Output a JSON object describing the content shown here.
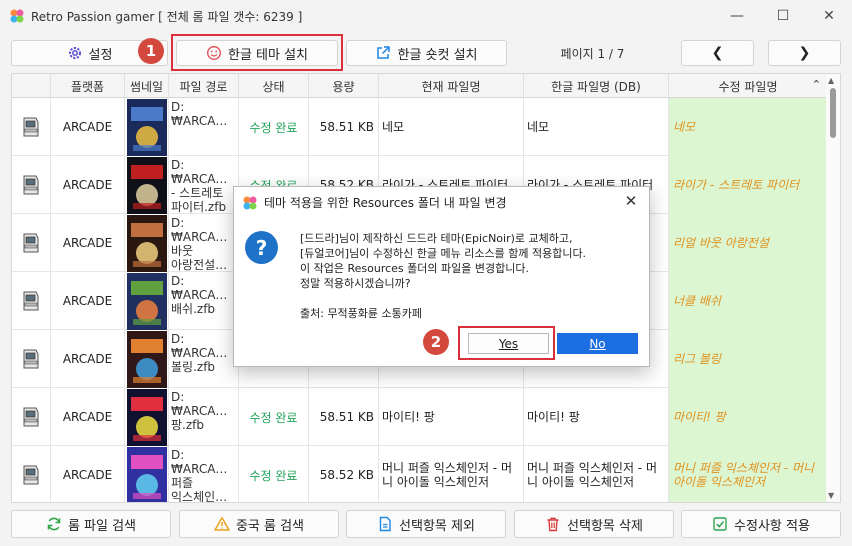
{
  "window": {
    "title": "Retro Passion gamer [ 전체 롬 파일 갯수: 6239 ]",
    "minimize_glyph": "—",
    "maximize_glyph": "☐",
    "close_glyph": "✕"
  },
  "toolbar": {
    "settings_label": "설정",
    "korean_theme_label": "한글 테마 설치",
    "korean_shortcut_label": "한글 숏컷 설치",
    "page_info": "페이지 1 / 7",
    "prev_glyph": "❮",
    "next_glyph": "❯"
  },
  "annotations": {
    "step1": "1",
    "step2": "2",
    "color": "#d9303a"
  },
  "table": {
    "columns": [
      "",
      "플랫폼",
      "썸네일",
      "파일 경로",
      "상태",
      "용량",
      "현재 파일명",
      "한글 파일명 (DB)",
      "수정 파일명"
    ],
    "sort_indicator": "⌃",
    "rows": [
      {
        "platform": "ARCADE",
        "path": "D:\n₩ARCA…",
        "status": "수정 완료",
        "size": "58.51 KB",
        "current": "네모",
        "korean_db": "네모",
        "modified": "네모"
      },
      {
        "platform": "ARCADE",
        "path": "D:\n₩ARCA…\n- 스트레토\n파이터.zfb",
        "status": "수정 완료",
        "size": "58.52 KB",
        "current": "라이가 - 스트레토 파이터",
        "korean_db": "라이가 - 스트레토 파이터",
        "modified": "라이가 - 스트레토 파이터"
      },
      {
        "platform": "ARCADE",
        "path": "D:\n₩ARCA…\n바웃\n아랑전설…",
        "status": "",
        "size": "",
        "current": "",
        "korean_db": "",
        "modified": "리얼 바웃 아랑전설"
      },
      {
        "platform": "ARCADE",
        "path": "D:\n₩ARCA…\n배쉬.zfb",
        "status": "",
        "size": "",
        "current": "",
        "korean_db": "",
        "modified": "너클 배쉬"
      },
      {
        "platform": "ARCADE",
        "path": "D:\n₩ARCA…\n볼링.zfb",
        "status": "",
        "size": "",
        "current": "",
        "korean_db": "",
        "modified": "리그 볼링"
      },
      {
        "platform": "ARCADE",
        "path": "D:\n₩ARCA…\n팡.zfb",
        "status": "수정 완료",
        "size": "58.51 KB",
        "current": "마이티! 팡",
        "korean_db": "마이티! 팡",
        "modified": "마이티! 팡"
      },
      {
        "platform": "ARCADE",
        "path": "D:\n₩ARCA…\n퍼즐\n익스체인…",
        "status": "수정 완료",
        "size": "58.52 KB",
        "current": "머니 퍼즐 익스체인저 - 머니 아이돌 익스체인저",
        "korean_db": "머니 퍼즐 익스체인저 - 머니 아이돌 익스체인저",
        "modified": "머니 퍼즐 익스체인저 - 머니 아이돌 익스체인저"
      }
    ]
  },
  "dialog": {
    "title": "테마 적용을 위한 Resources 폴더 내 파일 변경",
    "close_glyph": "✕",
    "question_glyph": "?",
    "line1": "[드드라]님이 제작하신 드드라 테마(EpicNoir)로 교체하고,",
    "line2": "[듀얼코어]님이 수정하신 한글 메뉴 리소스를 함께 적용합니다.",
    "line3": "이 작업은 Resources 폴더의 파일을 변경합니다.",
    "line4": "정말 적용하시겠습니까?",
    "source": "출처: 무적풍화륜 소통카페",
    "yes_label": "Yes",
    "no_label": "No"
  },
  "bottom": {
    "search_label": "롬 파일 검색",
    "dup_label": "중국 롬 검색",
    "exclude_label": "선택항목 제외",
    "delete_label": "선택항목 삭제",
    "apply_label": "수정사항 적용"
  },
  "colors": {
    "accent": "#1d6ee0",
    "status_done": "#21a35a",
    "modified_text": "#e0921e",
    "modified_bg": "#dcf6d2",
    "badge": "#d3493e"
  }
}
